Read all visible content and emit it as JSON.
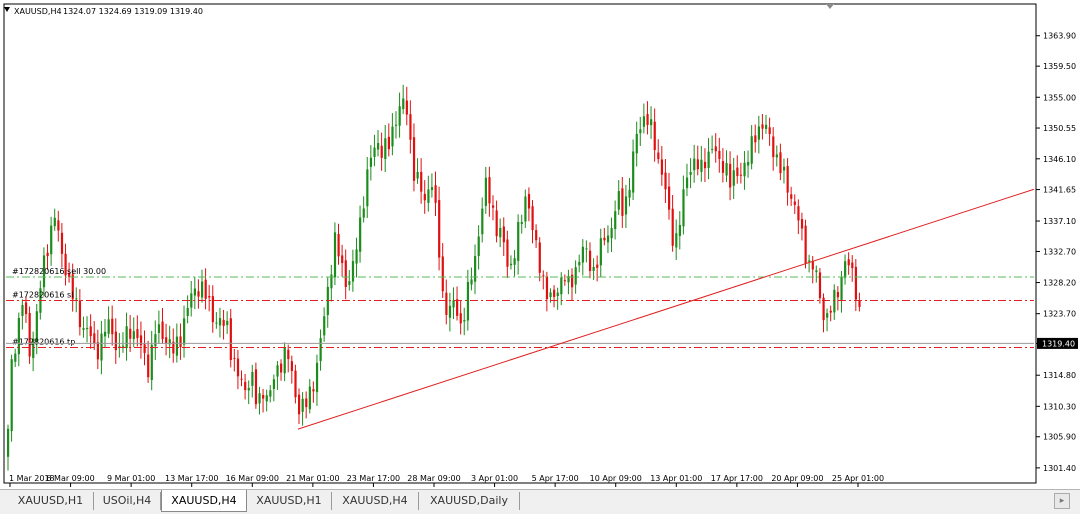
{
  "header": {
    "symbol": "XAUUSD,H4",
    "ohlc": "1324.07 1324.69 1319.09 1319.40"
  },
  "chart_data": {
    "type": "candlestick",
    "symbol": "XAUUSD",
    "timeframe": "H4",
    "y_range": [
      1299.5,
      1368.2
    ],
    "y_ticks": [
      "1363.90",
      "1359.50",
      "1355.00",
      "1350.55",
      "1346.10",
      "1341.65",
      "1337.10",
      "1332.70",
      "1328.20",
      "1323.70",
      "1319.40",
      "1314.80",
      "1310.30",
      "1305.90",
      "1301.40"
    ],
    "x_ticks": [
      "1 Mar 2018",
      "6 Mar 09:00",
      "9 Mar 01:00",
      "13 Mar 17:00",
      "16 Mar 09:00",
      "21 Mar 01:00",
      "23 Mar 17:00",
      "28 Mar 09:00",
      "3 Apr 01:00",
      "5 Apr 17:00",
      "10 Apr 09:00",
      "13 Apr 01:00",
      "17 Apr 17:00",
      "20 Apr 09:00",
      "25 Apr 01:00"
    ],
    "current_price": "1319.40",
    "up_color": "#1c8c1c",
    "down_color": "#e01010",
    "order_lines": [
      {
        "label": "#172820616 sell 30.00",
        "price": 1329.0,
        "color": "#55bb55"
      },
      {
        "label": "#172820616 sl",
        "price": 1325.6,
        "color": "#e02020"
      },
      {
        "label": "#172820616 tp",
        "price": 1318.8,
        "color": "#e02020"
      }
    ],
    "trendline": {
      "from": {
        "time": "16 Mar 2018",
        "price": 1307.0
      },
      "to": {
        "time": "26 Apr 2018",
        "price": 1341.7
      },
      "color": "#e02020"
    },
    "price_path": [
      [
        0,
        1303
      ],
      [
        4,
        1316
      ],
      [
        10,
        1321
      ],
      [
        16,
        1326
      ],
      [
        22,
        1318
      ],
      [
        28,
        1322
      ],
      [
        36,
        1330
      ],
      [
        42,
        1335
      ],
      [
        48,
        1338
      ],
      [
        53,
        1333
      ],
      [
        58,
        1331
      ],
      [
        64,
        1327
      ],
      [
        70,
        1324
      ],
      [
        76,
        1322
      ],
      [
        82,
        1321
      ],
      [
        88,
        1318
      ],
      [
        94,
        1320
      ],
      [
        100,
        1322
      ],
      [
        106,
        1321
      ],
      [
        112,
        1318
      ],
      [
        118,
        1320
      ],
      [
        124,
        1322
      ],
      [
        130,
        1320
      ],
      [
        136,
        1318
      ],
      [
        142,
        1316
      ],
      [
        148,
        1321
      ],
      [
        155,
        1321
      ],
      [
        160,
        1320
      ],
      [
        166,
        1318
      ],
      [
        172,
        1320
      ],
      [
        178,
        1323
      ],
      [
        184,
        1326
      ],
      [
        190,
        1328
      ],
      [
        196,
        1327
      ],
      [
        202,
        1325
      ],
      [
        208,
        1323
      ],
      [
        214,
        1322
      ],
      [
        220,
        1322
      ],
      [
        226,
        1317
      ],
      [
        232,
        1314
      ],
      [
        238,
        1313
      ],
      [
        244,
        1315
      ],
      [
        250,
        1310
      ],
      [
        256,
        1313
      ],
      [
        262,
        1311
      ],
      [
        268,
        1315
      ],
      [
        274,
        1317
      ],
      [
        280,
        1318
      ],
      [
        286,
        1314
      ],
      [
        292,
        1310
      ],
      [
        298,
        1310
      ],
      [
        304,
        1313
      ],
      [
        310,
        1316
      ],
      [
        316,
        1322
      ],
      [
        322,
        1329
      ],
      [
        328,
        1334
      ],
      [
        334,
        1331
      ],
      [
        340,
        1328
      ],
      [
        346,
        1330
      ],
      [
        352,
        1336
      ],
      [
        358,
        1342
      ],
      [
        364,
        1346
      ],
      [
        370,
        1349
      ],
      [
        376,
        1347
      ],
      [
        382,
        1348
      ],
      [
        388,
        1352
      ],
      [
        394,
        1354
      ],
      [
        400,
        1353
      ],
      [
        406,
        1345
      ],
      [
        412,
        1342
      ],
      [
        418,
        1340
      ],
      [
        424,
        1344
      ],
      [
        430,
        1336
      ],
      [
        436,
        1326
      ],
      [
        442,
        1324
      ],
      [
        448,
        1325
      ],
      [
        454,
        1322
      ],
      [
        460,
        1326
      ],
      [
        466,
        1330
      ],
      [
        472,
        1336
      ],
      [
        478,
        1342
      ],
      [
        484,
        1340
      ],
      [
        490,
        1336
      ],
      [
        496,
        1334
      ],
      [
        502,
        1330
      ],
      [
        508,
        1333
      ],
      [
        514,
        1337
      ],
      [
        520,
        1342
      ],
      [
        526,
        1335
      ],
      [
        532,
        1331
      ],
      [
        538,
        1328
      ],
      [
        544,
        1325
      ],
      [
        550,
        1327
      ],
      [
        556,
        1330
      ],
      [
        562,
        1327
      ],
      [
        568,
        1330
      ],
      [
        574,
        1333
      ],
      [
        580,
        1332
      ],
      [
        586,
        1330
      ],
      [
        592,
        1332
      ],
      [
        598,
        1335
      ],
      [
        604,
        1336
      ],
      [
        610,
        1340
      ],
      [
        616,
        1339
      ],
      [
        622,
        1342
      ],
      [
        628,
        1348
      ],
      [
        634,
        1352
      ],
      [
        640,
        1352
      ],
      [
        646,
        1349
      ],
      [
        652,
        1346
      ],
      [
        658,
        1342
      ],
      [
        664,
        1335
      ],
      [
        670,
        1335
      ],
      [
        676,
        1340
      ],
      [
        682,
        1345
      ],
      [
        688,
        1346
      ],
      [
        694,
        1344
      ],
      [
        700,
        1347
      ],
      [
        706,
        1348
      ],
      [
        712,
        1345
      ],
      [
        718,
        1346
      ],
      [
        724,
        1342
      ],
      [
        730,
        1344
      ],
      [
        736,
        1345
      ],
      [
        742,
        1346
      ],
      [
        748,
        1350
      ],
      [
        754,
        1351
      ],
      [
        760,
        1350
      ],
      [
        766,
        1348
      ],
      [
        772,
        1345
      ],
      [
        778,
        1343
      ],
      [
        784,
        1341
      ],
      [
        790,
        1338
      ],
      [
        796,
        1334
      ],
      [
        802,
        1331
      ],
      [
        808,
        1330
      ],
      [
        814,
        1325
      ],
      [
        820,
        1323
      ],
      [
        826,
        1325
      ],
      [
        832,
        1328
      ],
      [
        838,
        1331
      ],
      [
        844,
        1330
      ],
      [
        850,
        1327
      ],
      [
        856,
        1319.4
      ]
    ]
  },
  "tabs": [
    {
      "label": "XAUUSD,H1",
      "active": false
    },
    {
      "label": "USOil,H4",
      "active": false
    },
    {
      "label": "XAUUSD,H4",
      "active": true
    },
    {
      "label": "XAUUSD,H1",
      "active": false
    },
    {
      "label": "XAUUSD,H4",
      "active": false
    },
    {
      "label": "XAUUSD,Daily",
      "active": false
    }
  ]
}
